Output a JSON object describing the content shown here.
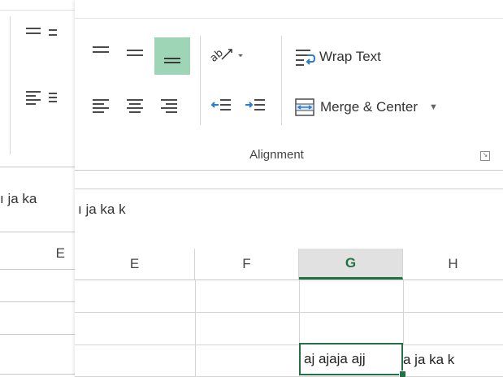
{
  "back_window": {
    "formula_text": "ı ja  ka",
    "column_label": "E"
  },
  "ribbon": {
    "wrap_text_label": "Wrap Text",
    "merge_center_label": "Merge & Center",
    "group_label": "Alignment",
    "accent_color": "#9fd5b7"
  },
  "formula_bar": {
    "text": "ı ja  ka  k"
  },
  "columns": [
    "E",
    "F",
    "G",
    "H"
  ],
  "active_column": "G",
  "rows": [
    {
      "E": "",
      "F": "",
      "G": "",
      "H": ""
    },
    {
      "E": "",
      "F": "",
      "G": "",
      "H": ""
    },
    {
      "E": "",
      "F": "",
      "G": "aj ajaja ajj",
      "H": "a ja  ka  k"
    }
  ],
  "colors": {
    "excel_green": "#217346"
  }
}
